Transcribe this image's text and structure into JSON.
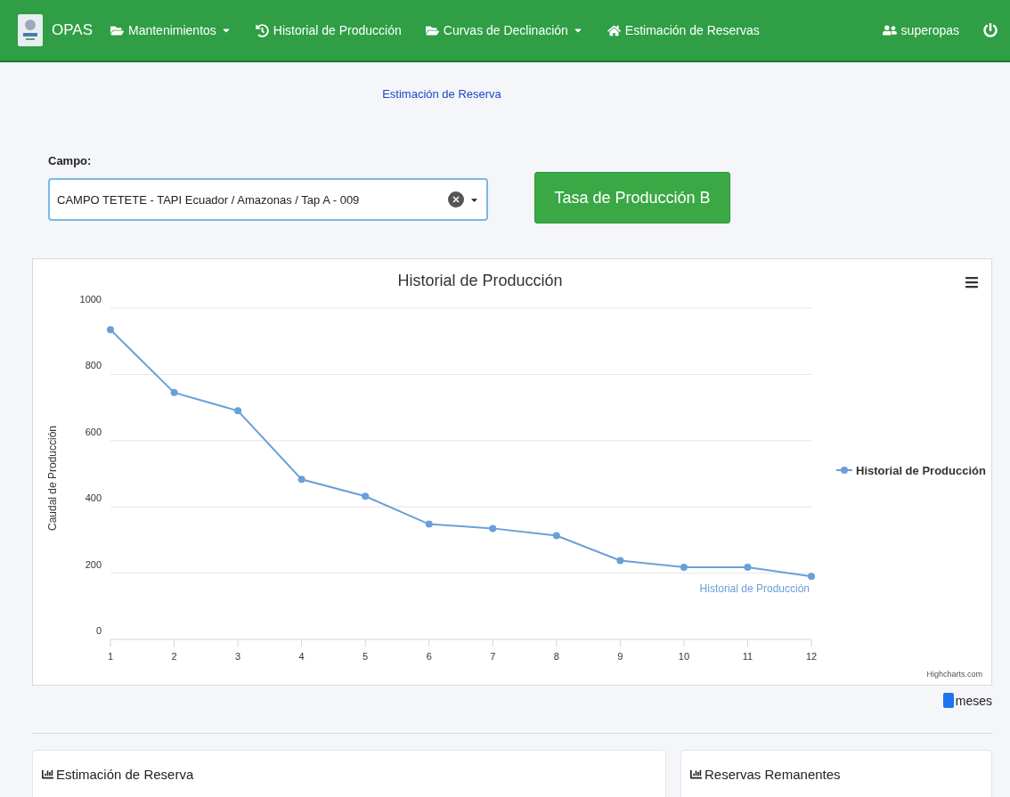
{
  "navbar": {
    "brand": "OPAS",
    "items": [
      {
        "label": "Mantenimientos",
        "kind": "folder",
        "dropdown": true
      },
      {
        "label": "Historial de Producción",
        "kind": "history",
        "dropdown": false
      },
      {
        "label": "Curvas de Declinación",
        "kind": "folder",
        "dropdown": true
      },
      {
        "label": "Estimación de Reservas",
        "kind": "home",
        "dropdown": false
      }
    ],
    "user": "superopas"
  },
  "breadcrumb": "Estimación de Reserva",
  "form": {
    "field_label": "Campo:",
    "field_value": "CAMPO TETETE - TAPI Ecuador / Amazonas / Tap A - 009",
    "button": "Tasa de Producción B"
  },
  "chart_panel": {
    "credits": "Highcharts.com",
    "footer_label": "meses",
    "chart_data": {
      "type": "line",
      "title": "Historial de Producción",
      "ylabel": "Caudal de Producción",
      "grid": true,
      "marker": true,
      "x": [
        1,
        2,
        3,
        4,
        5,
        6,
        7,
        8,
        9,
        10,
        11,
        12
      ],
      "xlim": [
        1,
        12
      ],
      "xticks": [
        1,
        2,
        3,
        4,
        5,
        6,
        7,
        8,
        9,
        10,
        11,
        12
      ],
      "ylim": [
        0,
        1000
      ],
      "yticks": [
        0,
        200,
        400,
        600,
        800,
        1000
      ],
      "series": [
        {
          "name": "Historial de Producción",
          "color": "#6a9fd8",
          "values": [
            935,
            745,
            690,
            483,
            432,
            348,
            335,
            313,
            238,
            218,
            218,
            190
          ]
        }
      ],
      "annotations": [
        {
          "x": 12,
          "y": 190,
          "text": "Historial de Producción"
        }
      ]
    }
  },
  "cards": [
    {
      "title": "Estimación de Reserva"
    },
    {
      "title": "Reservas Remanentes"
    }
  ]
}
